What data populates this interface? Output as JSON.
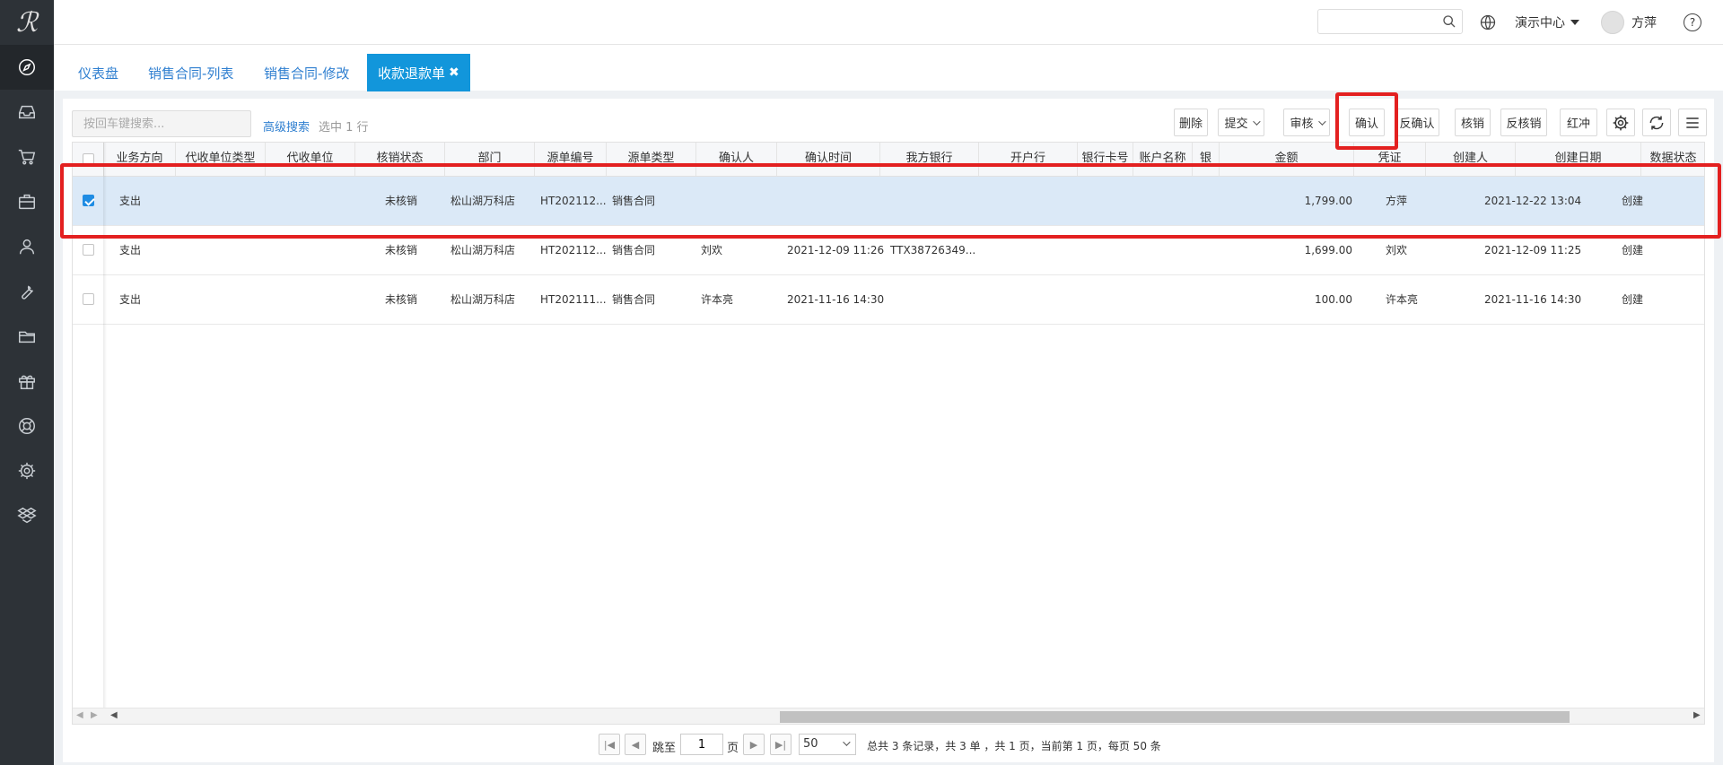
{
  "sidebar": {
    "logo": "ℛ",
    "items": [
      {
        "icon": "compass-icon",
        "active": true
      },
      {
        "icon": "inbox-icon"
      },
      {
        "icon": "cart-icon"
      },
      {
        "icon": "briefcase-icon"
      },
      {
        "icon": "user-icon"
      },
      {
        "icon": "wrench-icon"
      },
      {
        "icon": "folder-icon"
      },
      {
        "icon": "gift-icon"
      },
      {
        "icon": "lifebuoy-icon"
      },
      {
        "icon": "gear-icon"
      },
      {
        "icon": "dropbox-icon"
      }
    ]
  },
  "header": {
    "search_placeholder": "",
    "org_label": "演示中心",
    "user_name": "方萍",
    "help_label": "?"
  },
  "tabs": [
    {
      "label": "仪表盘"
    },
    {
      "label": "销售合同-列表"
    },
    {
      "label": "销售合同-修改"
    },
    {
      "label": "收款退款单",
      "active": true,
      "close": "✖"
    }
  ],
  "toolbar": {
    "search_placeholder": "按回车键搜索...",
    "advanced_search": "高级搜索",
    "selected_count": "选中 1 行",
    "buttons": {
      "delete": "删除",
      "submit": "提交",
      "audit": "审核",
      "confirm": "确认",
      "unconfirm": "反确认",
      "verify": "核销",
      "unverify": "反核销",
      "red_reverse": "红冲"
    }
  },
  "grid": {
    "columns": [
      "",
      "业务方向",
      "代收单位类型",
      "代收单位",
      "核销状态",
      "部门",
      "源单编号",
      "源单类型",
      "确认人",
      "确认时间",
      "我方银行",
      "开户行",
      "银行卡号",
      "账户名称",
      "银",
      "金额",
      "凭证",
      "创建人",
      "创建日期",
      "数据状态"
    ],
    "rows": [
      {
        "selected": true,
        "direction": "支出",
        "agent_type": "",
        "agent": "",
        "verify_status": "未核销",
        "dept": "松山湖万科店",
        "source_no": "HT202112...",
        "source_type": "销售合同",
        "confirmer": "",
        "confirm_time": "",
        "bank": "",
        "branch": "",
        "card": "",
        "account": "",
        "amount": "1,799.00",
        "voucher": "",
        "creator": "方萍",
        "created": "2021-12-22 13:04",
        "status": "创建"
      },
      {
        "selected": false,
        "direction": "支出",
        "agent_type": "",
        "agent": "",
        "verify_status": "未核销",
        "dept": "松山湖万科店",
        "source_no": "HT202112...",
        "source_type": "销售合同",
        "confirmer": "刘欢",
        "confirm_time": "2021-12-09 11:26",
        "bank": "TTX38726349...",
        "branch": "",
        "card": "",
        "account": "",
        "amount": "1,699.00",
        "voucher": "",
        "creator": "刘欢",
        "created": "2021-12-09 11:25",
        "status": "创建"
      },
      {
        "selected": false,
        "direction": "支出",
        "agent_type": "",
        "agent": "",
        "verify_status": "未核销",
        "dept": "松山湖万科店",
        "source_no": "HT202111...",
        "source_type": "销售合同",
        "confirmer": "许本亮",
        "confirm_time": "2021-11-16 14:30",
        "bank": "",
        "branch": "",
        "card": "",
        "account": "",
        "amount": "100.00",
        "voucher": "",
        "creator": "许本亮",
        "created": "2021-11-16 14:30",
        "status": "创建"
      }
    ]
  },
  "pager": {
    "jump_to": "跳至",
    "page_value": "1",
    "page_unit": "页",
    "page_size": "50",
    "summary": "总共 3 条记录，共 3 单 ，共 1 页，当前第 1 页，每页 50 条"
  },
  "colors": {
    "sidebar_bg": "#2d3237",
    "accent": "#1296db",
    "link": "#2f7fd0",
    "selected_row": "#dbe9f7",
    "highlight": "#e32020"
  }
}
